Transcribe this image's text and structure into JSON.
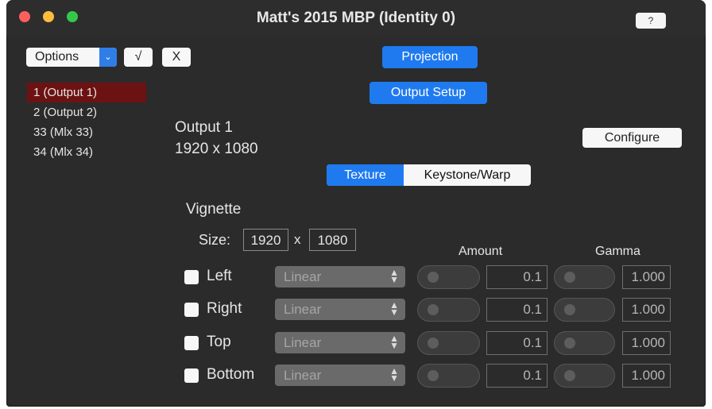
{
  "window": {
    "title": "Matt's 2015 MBP (Identity 0)",
    "help_label": "?"
  },
  "toolbar": {
    "options_label": "Options",
    "options_arrow": "⌄",
    "check_label": "√",
    "close_label": "X"
  },
  "outputs": {
    "items": [
      {
        "label": "1 (Output 1)",
        "selected": true
      },
      {
        "label": "2 (Output 2)",
        "selected": false
      },
      {
        "label": "33 (Mlx 33)",
        "selected": false
      },
      {
        "label": "34 (Mlx 34)",
        "selected": false
      }
    ]
  },
  "buttons": {
    "projection": "Projection",
    "output_setup": "Output Setup",
    "configure": "Configure"
  },
  "output_info": {
    "name": "Output 1",
    "resolution": "1920 x 1080"
  },
  "tabs": {
    "texture": "Texture",
    "keystone": "Keystone/Warp",
    "active": "Texture"
  },
  "vignette": {
    "title": "Vignette",
    "size_label": "Size:",
    "width": "1920",
    "separator": "x",
    "height": "1080",
    "amount_header": "Amount",
    "gamma_header": "Gamma",
    "rows": [
      {
        "label": "Left",
        "curve": "Linear",
        "amount": "0.1",
        "gamma": "1.000"
      },
      {
        "label": "Right",
        "curve": "Linear",
        "amount": "0.1",
        "gamma": "1.000"
      },
      {
        "label": "Top",
        "curve": "Linear",
        "amount": "0.1",
        "gamma": "1.000"
      },
      {
        "label": "Bottom",
        "curve": "Linear",
        "amount": "0.1",
        "gamma": "1.000"
      }
    ]
  },
  "colors": {
    "accent": "#1f7af0",
    "selected_row": "#6d1212",
    "window_bg": "#2b2b2b"
  }
}
